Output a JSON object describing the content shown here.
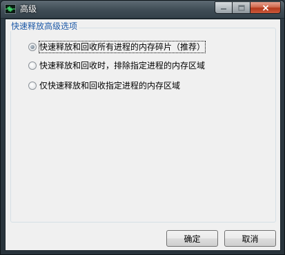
{
  "window": {
    "title": "高级",
    "icon": "app-waveform-icon"
  },
  "caption_buttons": {
    "minimize": "minimize-icon",
    "maximize": "maximize-icon",
    "close": "close-icon"
  },
  "group": {
    "title": "快速释放高级选项"
  },
  "options": [
    {
      "label": "快速释放和回收所有进程的内存碎片（推荐）",
      "selected": true
    },
    {
      "label": "快速释放和回收时，排除指定进程的内存区域",
      "selected": false
    },
    {
      "label": "仅快速释放和回收指定进程的内存区域",
      "selected": false
    }
  ],
  "buttons": {
    "ok": "确定",
    "cancel": "取消"
  },
  "colors": {
    "frame": "#2f3b44",
    "group_title": "#1e5aa8",
    "close_button": "#c9583a"
  }
}
